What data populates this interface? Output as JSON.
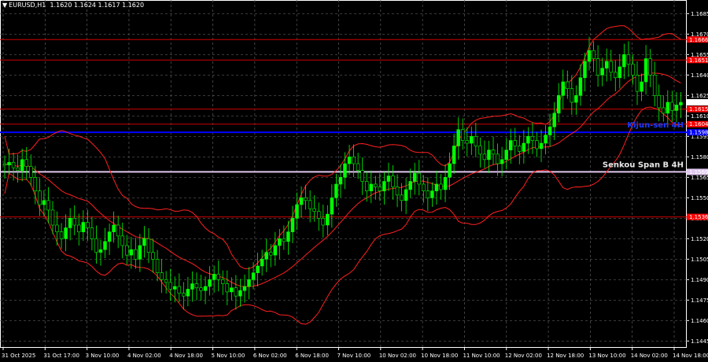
{
  "header": {
    "symbol": "EURUSD,H1",
    "ohlc": "1.1620 1.1624 1.1617 1.1620"
  },
  "colors": {
    "background": "#000000",
    "grid": "#5a5a5a",
    "bull_candle": "#00ff00",
    "bear_candle": "#00ff00",
    "bollinger": "#ff2020",
    "resistance_line": "#cc0000",
    "kijun_line": "#0000ff",
    "senkou_line": "#e0c8f0",
    "price_label_red": "#ff0000",
    "text": "#ffffff"
  },
  "chart_data": {
    "type": "candlestick",
    "symbol": "EURUSD",
    "timeframe": "H1",
    "ylim": [
      1.144,
      1.1695
    ],
    "y_ticks": [
      "1.1685",
      "1.1670",
      "1.1655",
      "1.1640",
      "1.1625",
      "1.1610",
      "1.1595",
      "1.1580",
      "1.1565",
      "1.1550",
      "1.1535",
      "1.1520",
      "1.1505",
      "1.1490",
      "1.1475",
      "1.1460",
      "1.1445"
    ],
    "x_ticks": [
      "31 Oct 2025",
      "31 Oct 17:00",
      "3 Nov 10:00",
      "4 Nov 02:00",
      "4 Nov 18:00",
      "5 Nov 10:00",
      "6 Nov 02:00",
      "6 Nov 18:00",
      "7 Nov 10:00",
      "10 Nov 02:00",
      "10 Nov 18:00",
      "11 Nov 10:00",
      "12 Nov 02:00",
      "12 Nov 18:00",
      "13 Nov 10:00",
      "14 Nov 02:00",
      "14 Nov 18:00"
    ],
    "current_price": {
      "value": 1.162,
      "label": "1.1620"
    },
    "horizontal_levels": [
      {
        "value": 1.1666,
        "label": "1.1666",
        "kind": "resistance"
      },
      {
        "value": 1.1651,
        "label": "1.1651",
        "kind": "resistance"
      },
      {
        "value": 1.1615,
        "label": "1.1615",
        "kind": "resistance"
      },
      {
        "value": 1.1604,
        "label": "1.1604",
        "kind": "resistance"
      },
      {
        "value": 1.1598,
        "label": "1.1598",
        "kind": "kijun",
        "name": "Kijun-sen 4H"
      },
      {
        "value": 1.1569,
        "label": "1.1569",
        "kind": "senkou",
        "name": "Senkou Span B 4H"
      },
      {
        "value": 1.1536,
        "label": "1.1536",
        "kind": "resistance"
      }
    ],
    "closes": [
      1.1574,
      1.1576,
      1.1572,
      1.157,
      1.1578,
      1.1573,
      1.1565,
      1.1555,
      1.1545,
      1.1548,
      1.1541,
      1.153,
      1.1525,
      1.152,
      1.1528,
      1.1535,
      1.153,
      1.1525,
      1.1532,
      1.1528,
      1.152,
      1.151,
      1.1512,
      1.1518,
      1.1525,
      1.153,
      1.1522,
      1.1515,
      1.1508,
      1.1512,
      1.1505,
      1.1515,
      1.152,
      1.151,
      1.1505,
      1.1495,
      1.149,
      1.1488,
      1.1483,
      1.1485,
      1.148,
      1.1478,
      1.1483,
      1.1487,
      1.1484,
      1.1482,
      1.1485,
      1.149,
      1.1494,
      1.149,
      1.1487,
      1.1481,
      1.1484,
      1.1478,
      1.1482,
      1.1485,
      1.149,
      1.1495,
      1.15,
      1.1505,
      1.151,
      1.1508,
      1.1515,
      1.152,
      1.1518,
      1.1525,
      1.1535,
      1.1545,
      1.155,
      1.1548,
      1.1542,
      1.154,
      1.1535,
      1.153,
      1.1538,
      1.155,
      1.156,
      1.1565,
      1.1575,
      1.158,
      1.1575,
      1.157,
      1.1562,
      1.1555,
      1.156,
      1.1558,
      1.1555,
      1.1562,
      1.1566,
      1.1558,
      1.1552,
      1.1548,
      1.1556,
      1.1562,
      1.1568,
      1.156,
      1.1555,
      1.155,
      1.1555,
      1.156,
      1.1556,
      1.1565,
      1.1575,
      1.1588,
      1.16,
      1.1592,
      1.159,
      1.1595,
      1.1588,
      1.1582,
      1.1578,
      1.1585,
      1.1582,
      1.1575,
      1.1578,
      1.1585,
      1.1592,
      1.1588,
      1.1584,
      1.159,
      1.1595,
      1.1592,
      1.1586,
      1.159,
      1.1596,
      1.1602,
      1.1612,
      1.1625,
      1.1635,
      1.163,
      1.162,
      1.1625,
      1.1638,
      1.165,
      1.1658,
      1.1652,
      1.164,
      1.1645,
      1.165,
      1.1642,
      1.1638,
      1.1646,
      1.1655,
      1.1648,
      1.164,
      1.1628,
      1.1635,
      1.1652,
      1.164,
      1.1625,
      1.1616,
      1.1612,
      1.162,
      1.1614,
      1.1618,
      1.162
    ],
    "open": 1.1575
  }
}
